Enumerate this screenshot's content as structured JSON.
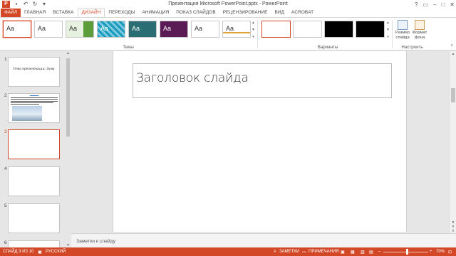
{
  "window": {
    "title": "Презентация Microsoft PowerPoint.pptx - PowerPoint",
    "app_logo": "P",
    "controls": [
      "?",
      "▭",
      "–",
      "□",
      "✕"
    ]
  },
  "qat": {
    "save_icon": "save-icon",
    "undo_icon": "undo-icon",
    "redo_icon": "redo-icon"
  },
  "tabs": [
    {
      "label": "ФАЙЛ"
    },
    {
      "label": "ГЛАВНАЯ"
    },
    {
      "label": "ВСТАВКА"
    },
    {
      "label": "ДИЗАЙН"
    },
    {
      "label": "ПЕРЕХОДЫ"
    },
    {
      "label": "АНИМАЦИЯ"
    },
    {
      "label": "ПОКАЗ СЛАЙДОВ"
    },
    {
      "label": "РЕЦЕНЗИРОВАНИЕ"
    },
    {
      "label": "ВИД"
    },
    {
      "label": "ACROBAT"
    }
  ],
  "ribbon": {
    "themes_label": "Темы",
    "variants_label": "Варианты",
    "customize_label": "Настроить",
    "slide_size_label": "Размер слайда",
    "format_bg_label": "Формат фона",
    "theme_sample": "Aa",
    "theme_colors": [
      "#ffffff",
      "#ffffff",
      "#e6f1df",
      "#1b9bbd",
      "#2a6e73",
      "#5b1c55",
      "#ffffff",
      "#ffffff"
    ],
    "variant_colors": [
      "#ffffff",
      "#ffffff",
      "#000000",
      "#000000"
    ]
  },
  "thumbnails": {
    "slides": [
      {
        "num": "1",
        "text": "Тема презентации: Зима"
      },
      {
        "num": "2",
        "text": ""
      },
      {
        "num": "3",
        "text": ""
      },
      {
        "num": "4",
        "text": ""
      },
      {
        "num": "5",
        "text": ""
      },
      {
        "num": "6",
        "text": ""
      }
    ]
  },
  "slide": {
    "title_placeholder": "Заголовок слайда"
  },
  "notes": {
    "label": "Заметки к слайду"
  },
  "status": {
    "slide_info": "СЛАЙД 3 ИЗ 10",
    "language": "РУССКИЙ",
    "notes_btn": "ЗАМЕТКИ",
    "comments_btn": "ПРИМЕЧАНИЯ",
    "zoom_minus": "–",
    "zoom_plus": "+",
    "zoom": "70%"
  },
  "colors": {
    "accent": "#d24726"
  }
}
